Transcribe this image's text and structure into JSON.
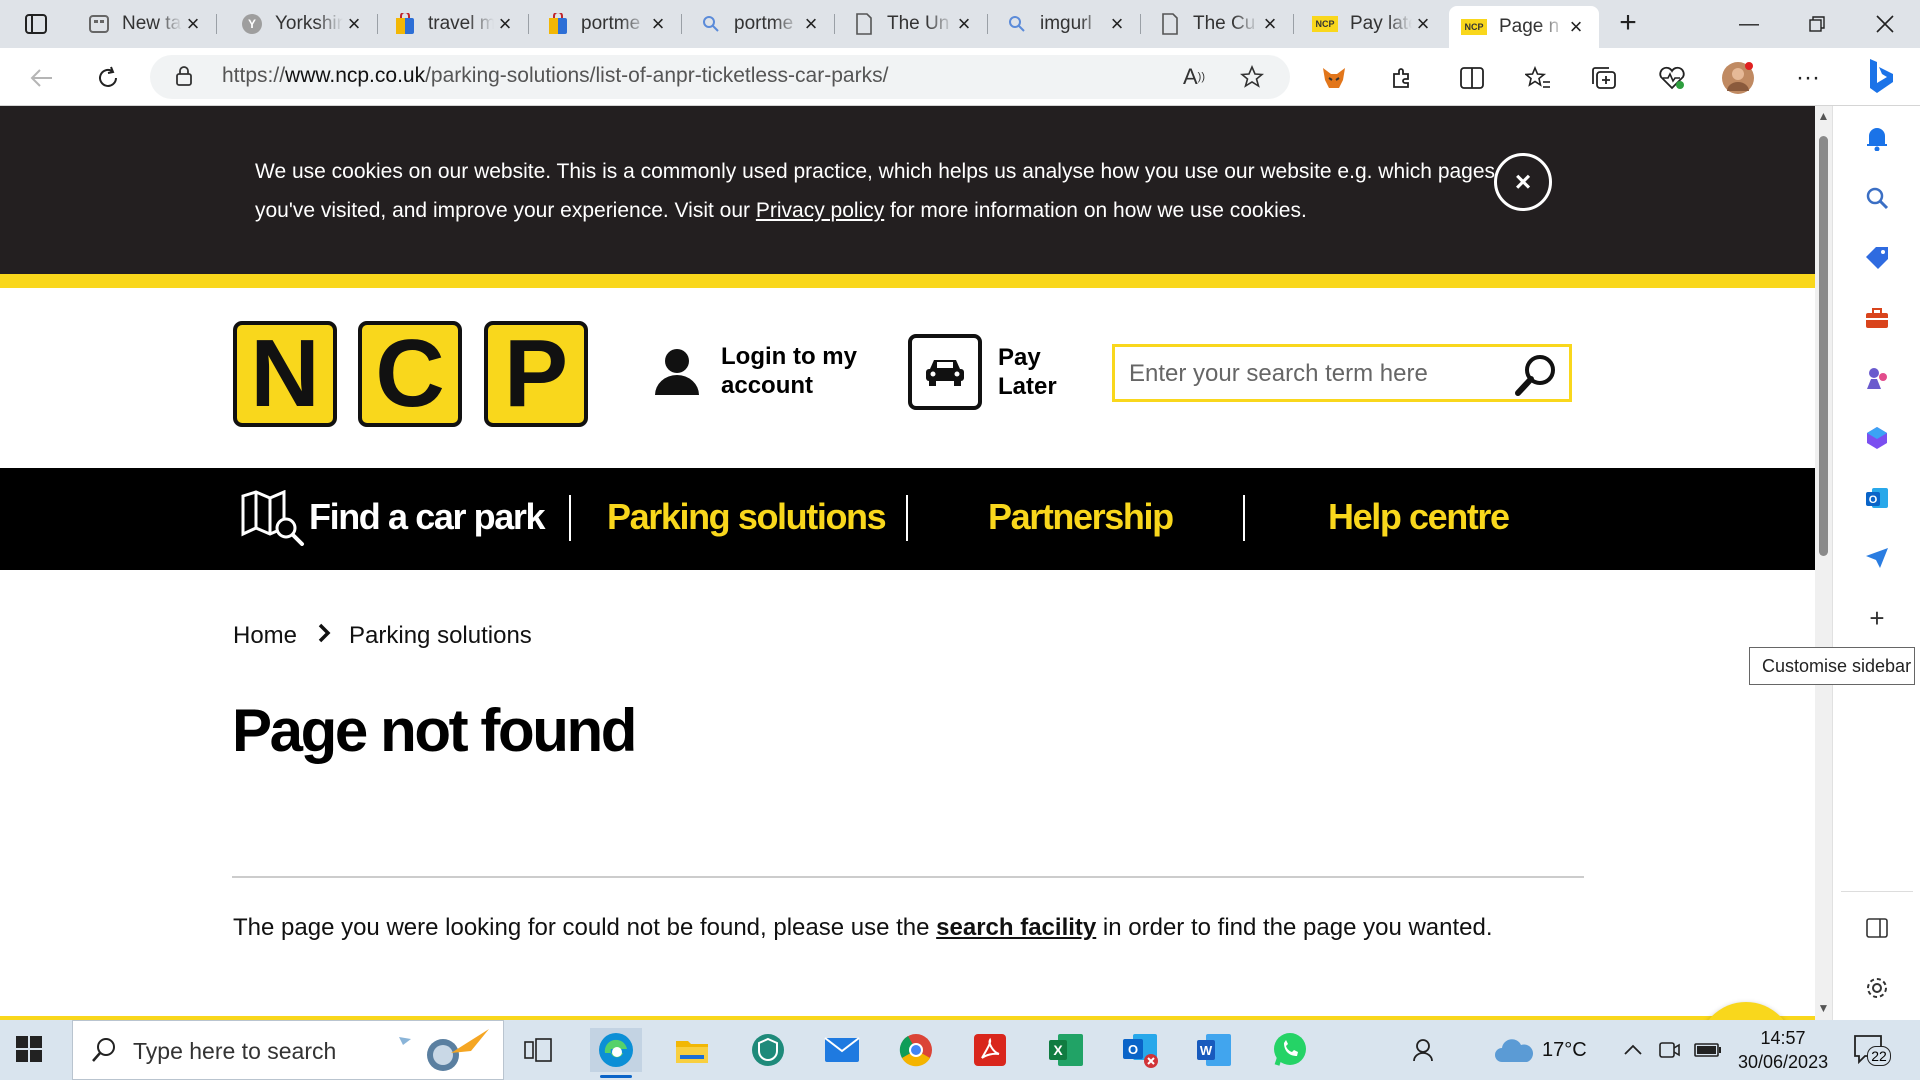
{
  "browser": {
    "tabs": [
      {
        "label": "New tab",
        "icon": "newtab-icon"
      },
      {
        "label": "Yorkshire",
        "icon": "yorkshire-icon"
      },
      {
        "label": "travel m",
        "icon": "bag-icon"
      },
      {
        "label": "portme",
        "icon": "bag-icon"
      },
      {
        "label": "portme",
        "icon": "search-icon"
      },
      {
        "label": "The Un",
        "icon": "document-icon"
      },
      {
        "label": "imgurl",
        "icon": "search-icon"
      },
      {
        "label": "The Cu",
        "icon": "document-icon"
      },
      {
        "label": "Pay late",
        "icon": "ncp-favicon"
      },
      {
        "label": "Page n",
        "icon": "ncp-favicon"
      }
    ],
    "favicon_text": "NCP",
    "url_prefix": "https://",
    "url_host": "www.ncp.co.uk",
    "url_path": "/parking-solutions/list-of-anpr-ticketless-car-parks/",
    "tooltip": "Customise sidebar"
  },
  "cookie_banner": {
    "text_before": "We use cookies on our website. This is a commonly used practice, which helps us analyse how you use our website e.g. which pages you've visited, and improve your experience. Visit our ",
    "link": "Privacy policy",
    "text_after": " for more information on how we use cookies.",
    "close_symbol": "×"
  },
  "header": {
    "logo_letters": [
      "N",
      "C",
      "P"
    ],
    "login_line1": "Login to my",
    "login_line2": "account",
    "paylater_line1": "Pay",
    "paylater_line2": "Later",
    "search_placeholder": "Enter your search term here"
  },
  "nav": {
    "find": "Find a car park",
    "parking": "Parking solutions",
    "partnership": "Partnership",
    "help": "Help centre"
  },
  "breadcrumb": {
    "home": "Home",
    "current": "Parking solutions"
  },
  "content": {
    "title": "Page not found",
    "message_before": "The page you were looking for could not be found, please use the ",
    "message_link": "search facility",
    "message_after": " in order to find the page you wanted."
  },
  "taskbar": {
    "search_placeholder": "Type here to search",
    "weather": "17°C",
    "time": "14:57",
    "date": "30/06/2023",
    "notifications": "22"
  },
  "colors": {
    "ncp_yellow": "#f9d71c",
    "banner_dark": "#231f20",
    "nav_black": "#000000"
  }
}
